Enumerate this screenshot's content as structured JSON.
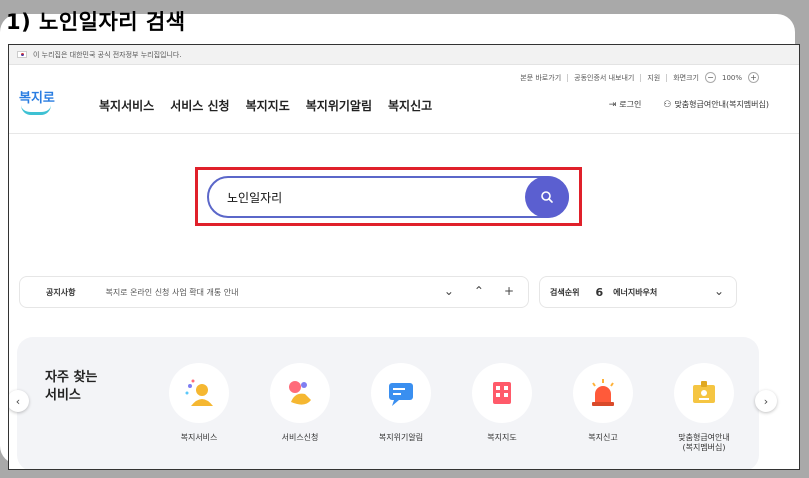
{
  "step": {
    "title": "1) 노인일자리 검색"
  },
  "gov_banner": {
    "text": "이 누리집은 대한민국 공식 전자정부 누리집입니다."
  },
  "util_bar": {
    "items": [
      "본문 바로가기",
      "공동인증서 내보내기",
      "지원",
      "화면크기"
    ],
    "zoom": "100%",
    "minus": "−",
    "plus": "+"
  },
  "logo": {
    "text": "복지로"
  },
  "nav": {
    "items": [
      "복지서비스",
      "서비스 신청",
      "복지지도",
      "복지위기알림",
      "복지신고"
    ]
  },
  "header_right": {
    "login": "로그인",
    "custom_guide": "맞춤형급여안내(복지멤버십)"
  },
  "search": {
    "value": "노인일자리"
  },
  "notice": {
    "label": "공지사항",
    "text": "복지로 온라인 신청 사업 확대 개통 안내",
    "down": "⌄",
    "up": "⌃",
    "plus": "+"
  },
  "rank": {
    "label": "검색순위",
    "number": "6",
    "term": "에너지바우처",
    "chevron": "⌄"
  },
  "favorites": {
    "title_line1": "자주 찾는",
    "title_line2": "서비스",
    "prev": "‹",
    "next": "›",
    "items": [
      {
        "label": "복지서비스"
      },
      {
        "label": "서비스신청"
      },
      {
        "label": "복지위기알림"
      },
      {
        "label": "복지지도"
      },
      {
        "label": "복지신고"
      },
      {
        "label_line1": "맞춤형급여안내",
        "label_line2": "(복지멤버십)"
      }
    ]
  },
  "colors": {
    "highlight": "#e0202a",
    "search_accent": "#5b5fd0",
    "brand": "#2a7de1"
  }
}
